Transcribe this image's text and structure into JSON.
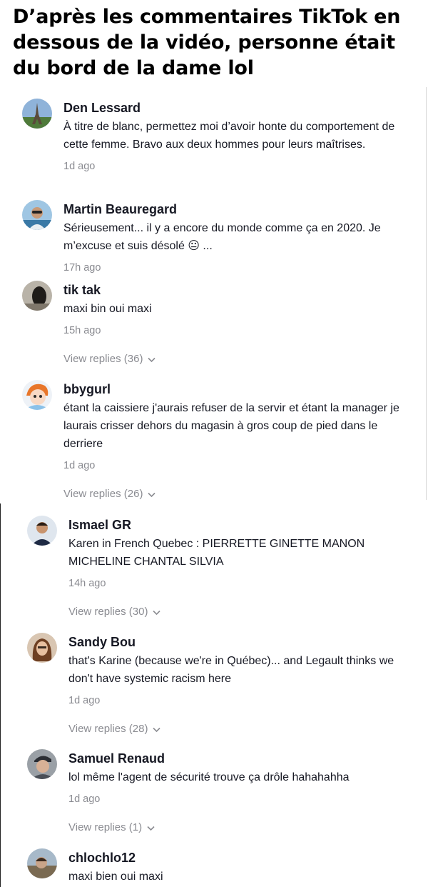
{
  "caption": "D’après les commentaires TikTok en dessous de la vidéo, personne était du bord de la dame lol",
  "comments": [
    {
      "username": "Den Lessard",
      "text": "À titre de blanc, permettez moi d’avoir honte du comportement de cette femme. Bravo aux deux hommes pour leurs maîtrises.",
      "time": "1d ago",
      "avatar": "eiffel-tower-avatar"
    },
    {
      "username": "Martin Beauregard",
      "text": "Sérieusement... il y a encore du monde comme ça en 2020. Je m’excuse et suis désolé 😐 ...",
      "time": "17h ago",
      "avatar": "man-sunglasses-avatar"
    },
    {
      "username": "tik tak",
      "text": "maxi bin oui maxi",
      "time": "15h ago",
      "replies": "View replies (36)",
      "avatar": "dark-photo-avatar"
    },
    {
      "username": "bbygurl",
      "text": "étant la caissiere j'aurais refuser de la servir et étant la manager je laurais crisser dehors du magasin à gros coup de pied dans le derriere",
      "time": "1d ago",
      "replies": "View replies (26)",
      "avatar": "cartoon-girl-avatar"
    },
    {
      "username": "Ismael GR",
      "text": "Karen in French Quebec : PIERRETTE GINETTE MANON MICHELINE CHANTAL SILVIA",
      "time": "14h ago",
      "replies": "View replies (30)",
      "avatar": "man-portrait-avatar"
    },
    {
      "username": "Sandy Bou",
      "text": "that's Karine (because we're in Québec)... and Legault thinks we don't have systemic racism here",
      "time": "1d ago",
      "replies": "View replies (28)",
      "avatar": "woman-portrait-avatar"
    },
    {
      "username": "Samuel Renaud",
      "text": "lol même l'agent de sécurité trouve ça drôle hahahahha",
      "time": "1d ago",
      "replies": "View replies (1)",
      "avatar": "man-cap-avatar"
    },
    {
      "username": "chlochlo12",
      "text": "maxi bien oui maxi",
      "avatar": "outdoor-photo-avatar"
    }
  ],
  "colors": {
    "text": "#161823",
    "meta": "#8a8b91",
    "caption": "#000000"
  }
}
